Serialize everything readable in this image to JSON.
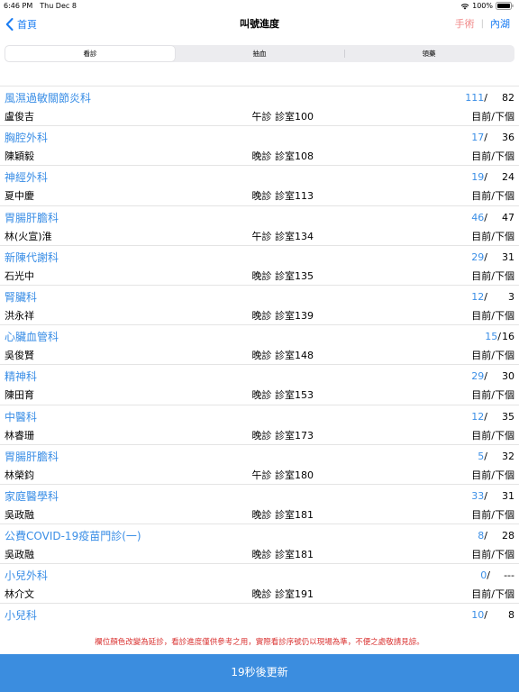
{
  "status_bar": {
    "time": "6:46 PM",
    "date": "Thu Dec 8",
    "battery": "100%"
  },
  "nav": {
    "back_label": "首頁",
    "title": "叫號進度",
    "right_link_1": "手術",
    "right_separator": "|",
    "right_link_2": "內湖"
  },
  "segments": [
    "看診",
    "抽血",
    "領藥"
  ],
  "rows": [
    {
      "dept": "風濕過敏關節炎科",
      "doctor": "盧俊吉",
      "room": "午診 診室100",
      "current": "111",
      "total": "82",
      "hint": "目前/下個"
    },
    {
      "dept": "胸腔外科",
      "doctor": "陳穎毅",
      "room": "晚診 診室108",
      "current": "17",
      "total": "36",
      "hint": "目前/下個"
    },
    {
      "dept": "神經外科",
      "doctor": "夏中慶",
      "room": "晚診 診室113",
      "current": "19",
      "total": "24",
      "hint": "目前/下個"
    },
    {
      "dept": "胃腸肝膽科",
      "doctor": "林(火宣)淮",
      "room": "午診 診室134",
      "current": "46",
      "total": "47",
      "hint": "目前/下個"
    },
    {
      "dept": "新陳代謝科",
      "doctor": "石光中",
      "room": "晚診 診室135",
      "current": "29",
      "total": "31",
      "hint": "目前/下個"
    },
    {
      "dept": "腎臟科",
      "doctor": "洪永祥",
      "room": "晚診 診室139",
      "current": "12",
      "total": "3",
      "hint": "目前/下個"
    },
    {
      "dept": "心臟血管科",
      "doctor": "吳俊賢",
      "room": "晚診 診室148",
      "current": "15",
      "total": "16",
      "hint": "目前/下個"
    },
    {
      "dept": "精神科",
      "doctor": "陳田育",
      "room": "晚診 診室153",
      "current": "29",
      "total": "30",
      "hint": "目前/下個"
    },
    {
      "dept": "中醫科",
      "doctor": "林睿珊",
      "room": "晚診 診室173",
      "current": "12",
      "total": "35",
      "hint": "目前/下個"
    },
    {
      "dept": "胃腸肝膽科",
      "doctor": "林榮鈞",
      "room": "午診 診室180",
      "current": "5",
      "total": "32",
      "hint": "目前/下個"
    },
    {
      "dept": "家庭醫學科",
      "doctor": "吳政融",
      "room": "晚診 診室181",
      "current": "33",
      "total": "31",
      "hint": "目前/下個"
    },
    {
      "dept": "公費COVID-19疫苗門診(一)",
      "doctor": "吳政融",
      "room": "晚診 診室181",
      "current": "8",
      "total": "28",
      "hint": "目前/下個"
    },
    {
      "dept": "小兒外科",
      "doctor": "林介文",
      "room": "晚診 診室191",
      "current": "0",
      "total": "---",
      "hint": "目前/下個"
    },
    {
      "dept": "小兒科",
      "doctor": "",
      "room": "",
      "current": "10",
      "total": "8",
      "hint": ""
    }
  ],
  "notice": "欄位顏色改變為延診，看診進度僅供參考之用，實際看診序號仍以現場為準，不便之處敬請見諒。",
  "refresh_button": "19秒後更新",
  "colors": {
    "accent": "#1a7cf2",
    "dept_blue": "#3a8ee6",
    "notice_red": "#d9302f",
    "button_bg": "#3b8ddf",
    "surgery_pink": "#f08a8a"
  }
}
